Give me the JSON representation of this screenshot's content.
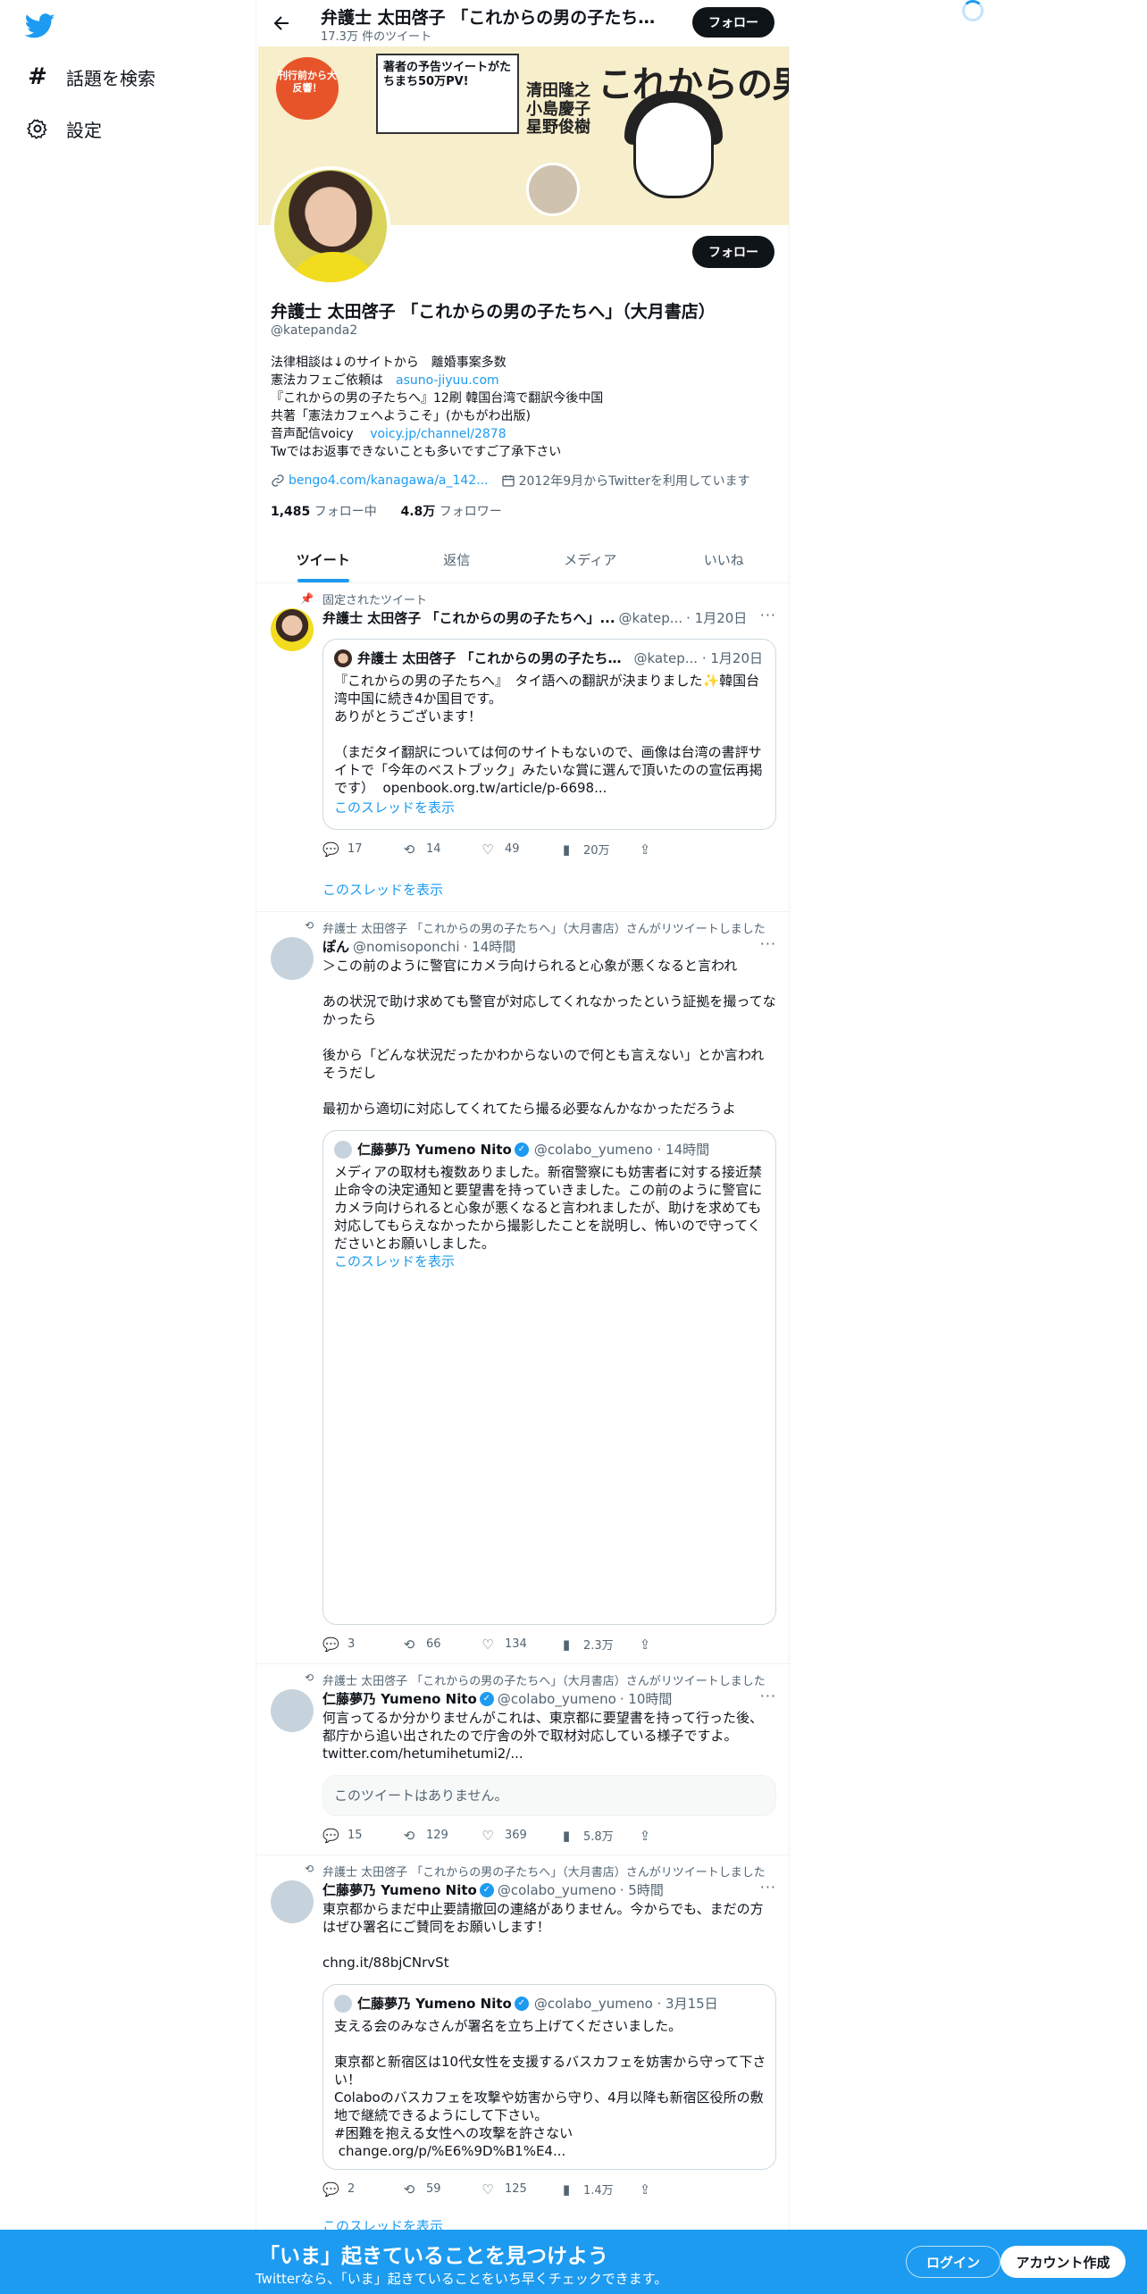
{
  "nav": {
    "explore_label": "話題を検索",
    "settings_label": "設定"
  },
  "header": {
    "title": "弁護士 太田啓子 「これからの男の子たちへ」（大月書店）",
    "tweet_count": "17.3万 件のツイート",
    "follow_label": "フォロー"
  },
  "banner": {
    "badge_text": "刊行前から大反響！",
    "box_text": "著者の予告ツイートがたちまち50万PV!",
    "title_text": "これからの男の子たちへ",
    "names_text": "清田隆之 小島慶子 星野俊樹"
  },
  "profile": {
    "name": "弁護士 太田啓子 「これからの男の子たちへ」（大月書店）",
    "handle": "@katepanda2",
    "bio_line1": "法律相談は↓のサイトから　離婚事案多数",
    "bio_line2_prefix": "憲法カフェご依頼は　",
    "bio_line2_link": "asuno-jiyuu.com",
    "bio_line3": "『これからの男の子たちへ』12刷 韓国台湾で翻訳今後中国",
    "bio_line4": "共著「憲法カフェへようこそ」(かもがわ出版)",
    "bio_line5_prefix": "音声配信voicy　 ",
    "bio_line5_link": "voicy.jp/channel/2878",
    "bio_line6": "Twではお返事できないことも多いですご了承下さい",
    "website": "bengo4.com/kanagawa/a_142...",
    "joined": "2012年9月からTwitterを利用しています",
    "following_count": "1,485",
    "following_label": "フォロー中",
    "followers_count": "4.8万",
    "followers_label": "フォロワー",
    "follow_label": "フォロー"
  },
  "tabs": [
    "ツイート",
    "返信",
    "メディア",
    "いいね"
  ],
  "tweets": [
    {
      "context": "固定されたツイート",
      "name": "弁護士 太田啓子 「これからの男の子たちへ」...",
      "handle": "@katep...",
      "time": "· 1月20日",
      "quote": {
        "name": "弁護士 太田啓子 「これからの男の子たちへ」...",
        "handle": "@katep... · 1月20日",
        "text": "『これからの男の子たちへ』　タイ語への翻訳が決まりました✨韓国台湾中国に続き4か国目です。\nありがとうございます！\n\n（まだタイ翻訳については何のサイトもないので、画像は台湾の書評サイトで「今年のベストブック」みたいな賞に選んで頂いたのの宣伝再掲です）  openbook.org.tw/article/p-6698...",
        "show_thread": "このスレッドを表示"
      },
      "replies": "17",
      "retweets": "14",
      "likes": "49",
      "views": "20万",
      "show_thread": "このスレッドを表示"
    },
    {
      "context": "弁護士 太田啓子 「これからの男の子たちへ」（大月書店）さんがリツイートしました",
      "name": "ぽん",
      "handle": "@nomisoponchi",
      "time": "· 14時間",
      "text": "＞この前のように警官にカメラ向けられると心象が悪くなると言われ\n\nあの状況で助け求めても警官が対応してくれなかったという証拠を撮ってなかったら\n\n後から「どんな状況だったかわからないので何とも言えない」とか言われそうだし\n\n最初から適切に対応してくれてたら撮る必要なんかなかっただろうよ",
      "quote": {
        "name": "仁藤夢乃 Yumeno Nito",
        "handle": "@colabo_yumeno · 14時間",
        "text": "メディアの取材も複数ありました。新宿警察にも妨害者に対する接近禁止命令の決定通知と要望書を持っていきました。この前のように警官にカメラ向けられると心象が悪くなると言われましたが、助けを求めても対応してもらえなかったから撮影したことを説明し、怖いので守ってくださいとお願いしました。",
        "show_thread": "このスレッドを表示"
      },
      "replies": "3",
      "retweets": "66",
      "likes": "134",
      "views": "2.3万"
    },
    {
      "context": "弁護士 太田啓子 「これからの男の子たちへ」（大月書店）さんがリツイートしました",
      "name": "仁藤夢乃 Yumeno Nito",
      "handle": "@colabo_yumeno",
      "time": "· 10時間",
      "text": "何言ってるか分かりませんがこれは、東京都に要望書を持って行った後、都庁から追い出されたので庁舎の外で取材対応している様子ですよ。",
      "link": "twitter.com/hetumihetumi2/...",
      "unavailable": "このツイートはありません。",
      "replies": "15",
      "retweets": "129",
      "likes": "369",
      "views": "5.8万"
    },
    {
      "context": "弁護士 太田啓子 「これからの男の子たちへ」（大月書店）さんがリツイートしました",
      "name": "仁藤夢乃 Yumeno Nito",
      "handle": "@colabo_yumeno",
      "time": "· 5時間",
      "text": "東京都からまだ中止要請撤回の連絡がありません。今からでも、まだの方はぜひ署名にご賛同をお願いします！",
      "link": "chng.it/88bjCNrvSt",
      "quote": {
        "name": "仁藤夢乃 Yumeno Nito",
        "handle": "@colabo_yumeno · 3月15日",
        "text": "支える会のみなさんが署名を立ち上げてくださいました。\n\n東京都と新宿区は10代女性を支援するバスカフェを妨害から守って下さい！\nColaboのバスカフェを攻撃や妨害から守り、4月以降も新宿区役所の敷地で継続できるようにして下さい。\n#困難を抱える女性への攻撃を許さない\n change.org/p/%E6%9D%B1%E4..."
      },
      "replies": "2",
      "retweets": "59",
      "likes": "125",
      "views": "1.4万",
      "show_thread": "このスレッドを表示"
    }
  ],
  "bottom_bar": {
    "title": "「いま」起きていることを見つけよう",
    "subtitle": "Twitterなら、「いま」起きていることをいち早くチェックできます。",
    "login": "ログイン",
    "signup": "アカウント作成"
  },
  "colors": {
    "accent": "#1d9bf0",
    "text": "#0f1419",
    "muted": "#536471"
  }
}
